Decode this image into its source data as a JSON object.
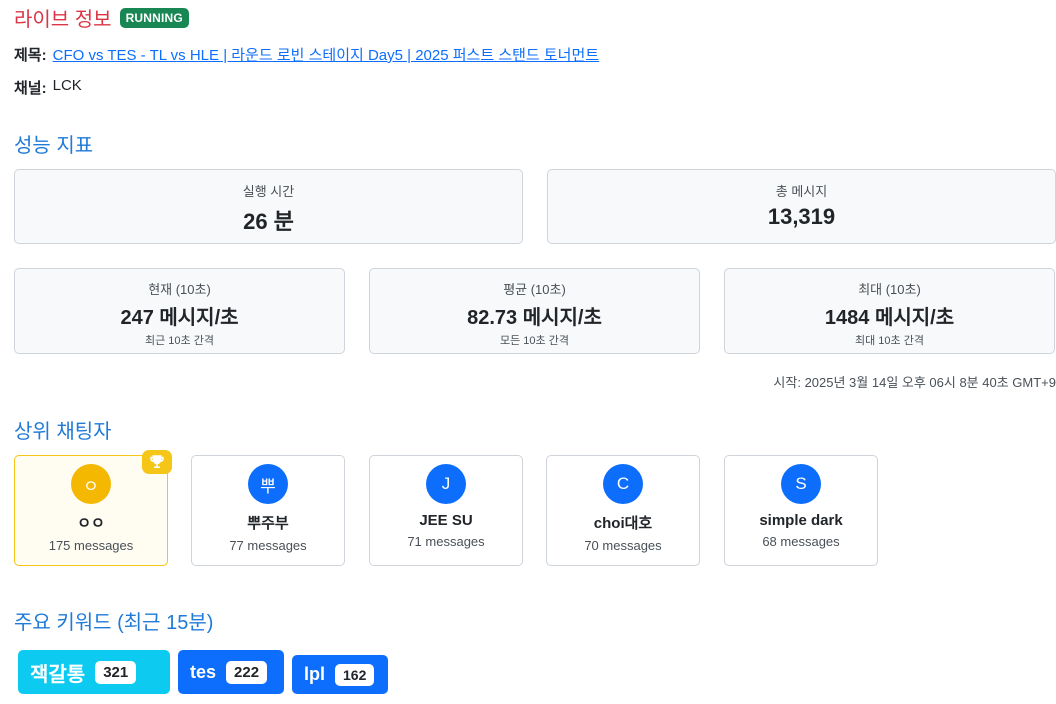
{
  "live": {
    "title": "라이브 정보",
    "status": "RUNNING"
  },
  "info": {
    "title_label": "제목:",
    "title_value": "CFO vs TES - TL vs HLE | 라운드 로빈 스테이지 Day5 | 2025 퍼스트 스탠드 토너먼트",
    "channel_label": "채널:",
    "channel_value": "LCK"
  },
  "metrics": {
    "title": "성능 지표",
    "runtime": {
      "label": "실행 시간",
      "value": "26 분"
    },
    "total": {
      "label": "총 메시지",
      "value": "13,319"
    },
    "current": {
      "label": "현재 (10초)",
      "value": "247 메시지/초",
      "sub": "최근 10초 간격"
    },
    "average": {
      "label": "평균 (10초)",
      "value": "82.73 메시지/초",
      "sub": "모든 10초 간격"
    },
    "max": {
      "label": "최대 (10초)",
      "value": "1484 메시지/초",
      "sub": "최대 10초 간격"
    },
    "started": "시작: 2025년 3월 14일 오후 06시 8분 40초 GMT+9"
  },
  "chatters": {
    "title": "상위 채팅자",
    "items": [
      {
        "initial": "ㅇ",
        "name": "ㅇㅇ",
        "count": "175 messages",
        "color": "#f5b800"
      },
      {
        "initial": "뿌",
        "name": "뿌주부",
        "count": "77 messages",
        "color": "#0d6efd"
      },
      {
        "initial": "J",
        "name": "JEE SU",
        "count": "71 messages",
        "color": "#0d6efd"
      },
      {
        "initial": "C",
        "name": "choi대호",
        "count": "70 messages",
        "color": "#0d6efd"
      },
      {
        "initial": "S",
        "name": "simple dark",
        "count": "68 messages",
        "color": "#0d6efd"
      }
    ]
  },
  "keywords": {
    "title": "주요 키워드 (최근 15분)",
    "items": [
      {
        "word": "잭갈통",
        "count": "321",
        "color": "#0dcaf0"
      },
      {
        "word": "tes",
        "count": "222",
        "color": "#0d6efd"
      },
      {
        "word": "lpl",
        "count": "162",
        "color": "#0d6efd"
      }
    ]
  }
}
